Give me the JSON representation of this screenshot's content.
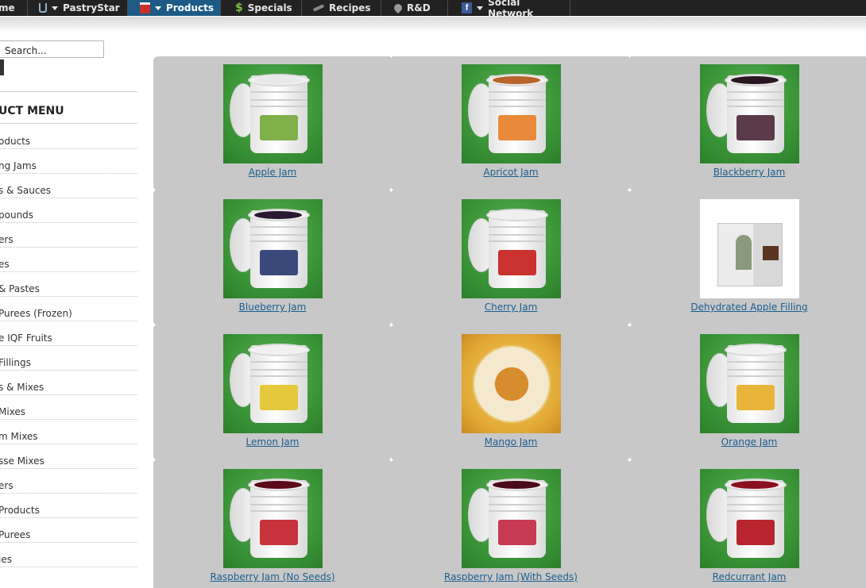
{
  "nav": {
    "items": [
      {
        "label": "me",
        "icon": "",
        "caret": false,
        "active": false
      },
      {
        "label": "PastryStar",
        "icon": "glass-icon",
        "caret": true,
        "active": false
      },
      {
        "label": "Products",
        "icon": "box-icon",
        "caret": true,
        "active": true
      },
      {
        "label": "Specials",
        "icon": "dollar-icon",
        "caret": false,
        "active": false
      },
      {
        "label": "Recipes",
        "icon": "whisk-icon",
        "caret": false,
        "active": false
      },
      {
        "label": "R&D",
        "icon": "pin-icon",
        "caret": false,
        "active": false
      },
      {
        "label": "Social Network",
        "icon": "facebook-icon",
        "caret": true,
        "active": false
      }
    ]
  },
  "search": {
    "value": "Search..."
  },
  "sidebar": {
    "title": "UCT MENU",
    "items": [
      "oducts",
      "ng Jams",
      "s & Sauces",
      "pounds",
      "ers",
      "es",
      " & Pastes",
      " Purees (Frozen)",
      "e IQF Fruits",
      " Fillings",
      "s & Mixes",
      " Mixes",
      "m Mixes",
      "sse Mixes",
      "ers",
      "Products",
      " Purees",
      "ies"
    ]
  },
  "products": [
    {
      "name": "Apple Jam",
      "kind": "bucket",
      "fill": "#e9e9e9",
      "label": "#7fb04a"
    },
    {
      "name": "Apricot Jam",
      "kind": "bucket",
      "fill": "#b8642a",
      "label": "#e88a3a"
    },
    {
      "name": "Blackberry Jam",
      "kind": "bucket",
      "fill": "#2a1620",
      "label": "#5b3a4a"
    },
    {
      "name": "Blueberry Jam",
      "kind": "bucket",
      "fill": "#2a1830",
      "label": "#3a4a7a"
    },
    {
      "name": "Cherry Jam",
      "kind": "bucket",
      "fill": "#efefef",
      "label": "#c9322e"
    },
    {
      "name": "Dehydrated Apple Filling",
      "kind": "box",
      "fill": "",
      "label": ""
    },
    {
      "name": "Lemon Jam",
      "kind": "bucket",
      "fill": "#f0f0f0",
      "label": "#e6c93a"
    },
    {
      "name": "Mango Jam",
      "kind": "donut",
      "fill": "",
      "label": ""
    },
    {
      "name": "Orange Jam",
      "kind": "bucket",
      "fill": "#f0f0f0",
      "label": "#e8b53a"
    },
    {
      "name": "Raspberry Jam (No Seeds)",
      "kind": "bucket",
      "fill": "#5a0a18",
      "label": "#c8323c"
    },
    {
      "name": "Raspberry Jam (With Seeds)",
      "kind": "bucket",
      "fill": "#4a0a1a",
      "label": "#c83a50"
    },
    {
      "name": "Redcurrant Jam",
      "kind": "bucket",
      "fill": "#8a1020",
      "label": "#b8252e"
    }
  ],
  "colors": {
    "nav_bg": "#222222",
    "nav_active": "#1d5a85",
    "link": "#1a5f8f",
    "panel": "#c8c8c8"
  }
}
